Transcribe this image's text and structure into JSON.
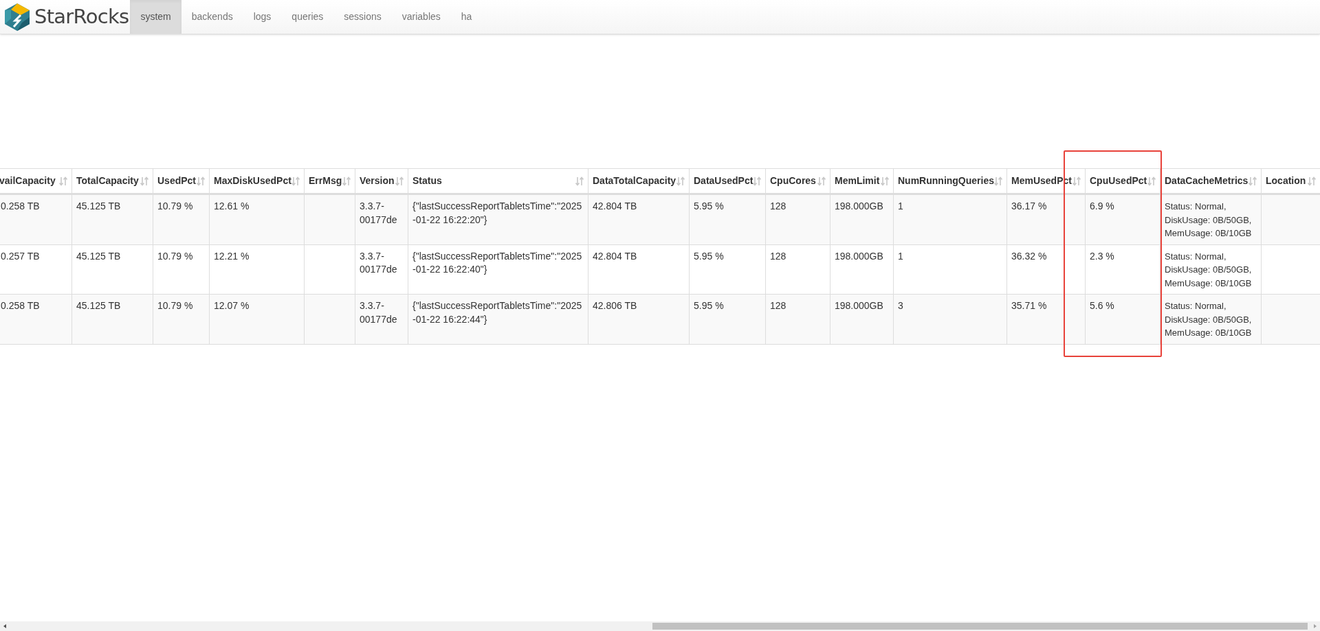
{
  "brand": {
    "name": "StarRocks"
  },
  "nav": [
    {
      "label": "system",
      "selected": true
    },
    {
      "label": "backends",
      "selected": false
    },
    {
      "label": "logs",
      "selected": false
    },
    {
      "label": "queries",
      "selected": false
    },
    {
      "label": "sessions",
      "selected": false
    },
    {
      "label": "variables",
      "selected": false
    },
    {
      "label": "ha",
      "selected": false
    }
  ],
  "table": {
    "columns": [
      "vailCapacity",
      "TotalCapacity",
      "UsedPct",
      "MaxDiskUsedPct",
      "ErrMsg",
      "Version",
      "Status",
      "DataTotalCapacity",
      "DataUsedPct",
      "CpuCores",
      "MemLimit",
      "NumRunningQueries",
      "MemUsedPct",
      "CpuUsedPct",
      "DataCacheMetrics",
      "Location"
    ],
    "rows": [
      [
        "0.258 TB",
        "45.125 TB",
        "10.79 %",
        "12.61 %",
        "",
        "3.3.7-00177de",
        "{\"lastSuccessReportTabletsTime\":\"2025-01-22 16:22:20\"}",
        "42.804 TB",
        "5.95 %",
        "128",
        "198.000GB",
        "1",
        "36.17 %",
        "6.9 %",
        "Status: Normal, DiskUsage: 0B/50GB, MemUsage: 0B/10GB",
        ""
      ],
      [
        "0.257 TB",
        "45.125 TB",
        "10.79 %",
        "12.21 %",
        "",
        "3.3.7-00177de",
        "{\"lastSuccessReportTabletsTime\":\"2025-01-22 16:22:40\"}",
        "42.804 TB",
        "5.95 %",
        "128",
        "198.000GB",
        "1",
        "36.32 %",
        "2.3 %",
        "Status: Normal, DiskUsage: 0B/50GB, MemUsage: 0B/10GB",
        ""
      ],
      [
        "0.258 TB",
        "45.125 TB",
        "10.79 %",
        "12.07 %",
        "",
        "3.3.7-00177de",
        "{\"lastSuccessReportTabletsTime\":\"2025-01-22 16:22:44\"}",
        "42.806 TB",
        "5.95 %",
        "128",
        "198.000GB",
        "3",
        "35.71 %",
        "5.6 %",
        "Status: Normal, DiskUsage: 0B/50GB, MemUsage: 0B/10GB",
        ""
      ]
    ]
  }
}
